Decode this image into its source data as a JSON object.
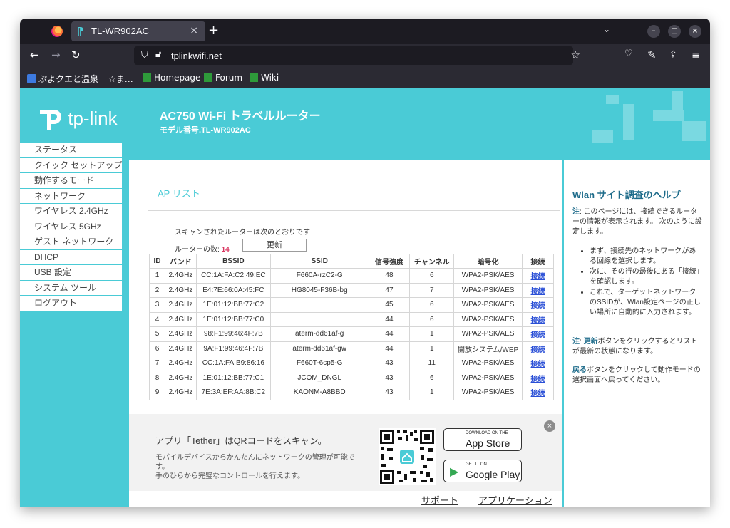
{
  "browser": {
    "tab_title": "TL-WR902AC",
    "tab_close": "×",
    "new_tab": "+",
    "url": "tplinkwifi.net",
    "bookmarks": [
      "ぷよクエと温泉",
      "☆ま…",
      "Homepage",
      "Forum",
      "Wiki"
    ]
  },
  "header": {
    "brand": "tp-link",
    "title": "AC750 Wi-Fi トラベルルーター",
    "model": "モデル番号.TL-WR902AC"
  },
  "sidebar": {
    "items": [
      "ステータス",
      "クイック セットアップ",
      "動作するモード",
      "ネットワーク",
      "ワイヤレス 2.4GHz",
      "ワイヤレス 5GHz",
      "ゲスト ネットワーク",
      "DHCP",
      "USB 設定",
      "システム ツール",
      "ログアウト"
    ]
  },
  "ap_list": {
    "title": "AP リスト",
    "scan_text": "スキャンされたルーターは次のとおりです",
    "count_label": "ルーターの数: ",
    "count": "14",
    "refresh_label": "更新",
    "columns": [
      "ID",
      "バンド",
      "BSSID",
      "SSID",
      "信号強度",
      "チャンネル",
      "暗号化",
      "接続"
    ],
    "rows": [
      [
        "1",
        "2.4GHz",
        "CC:1A:FA:C2:49:EC",
        "F660A-rzC2-G",
        "48",
        "6",
        "WPA2-PSK/AES",
        "接続"
      ],
      [
        "2",
        "2.4GHz",
        "E4:7E:66:0A:45:FC",
        "HG8045-F36B-bg",
        "47",
        "7",
        "WPA2-PSK/AES",
        "接続"
      ],
      [
        "3",
        "2.4GHz",
        "1E:01:12:BB:77:C2",
        "",
        "45",
        "6",
        "WPA2-PSK/AES",
        "接続"
      ],
      [
        "4",
        "2.4GHz",
        "1E:01:12:BB:77:C0",
        "",
        "44",
        "6",
        "WPA2-PSK/AES",
        "接続"
      ],
      [
        "5",
        "2.4GHz",
        "98:F1:99:46:4F:7B",
        "aterm-dd61af-g",
        "44",
        "1",
        "WPA2-PSK/AES",
        "接続"
      ],
      [
        "6",
        "2.4GHz",
        "9A:F1:99:46:4F:7B",
        "aterm-dd61af-gw",
        "44",
        "1",
        "開放システム/WEP",
        "接続"
      ],
      [
        "7",
        "2.4GHz",
        "CC:1A:FA:B9:86:16",
        "F660T-6cp5-G",
        "43",
        "11",
        "WPA2-PSK/AES",
        "接続"
      ],
      [
        "8",
        "2.4GHz",
        "1E:01:12:BB:77:C1",
        "JCOM_DNGL",
        "43",
        "6",
        "WPA2-PSK/AES",
        "接続"
      ],
      [
        "9",
        "2.4GHz",
        "7E:3A:EF:AA:8B:C2",
        "KAONM-A8BBD",
        "43",
        "1",
        "WPA2-PSK/AES",
        "接続"
      ]
    ]
  },
  "promo": {
    "heading": "アプリ「Tether」はQRコードをスキャン。",
    "body_1": "モバイルデバイスからかんたんにネットワークの管理が可能です。",
    "body_2": "手のひらから完璧なコントロールを行えます。",
    "appstore_small": "DOWNLOAD ON THE",
    "appstore_big": "App Store",
    "gplay_small": "GET IT ON",
    "gplay_big": "Google Play"
  },
  "footer": {
    "support": "サポート",
    "app": "アプリケーション"
  },
  "help": {
    "title": "Wlan サイト調査のヘルプ",
    "note_label": "注",
    "note1": ": このページには、接続できるルーターの情報が表示されます。 次のように設定します。",
    "steps": [
      "まず、接続先のネットワークがある回線を選択します。",
      "次に、その行の最後にある「接続」を確認します。",
      "これで、ターゲットネットワークのSSIDが、Wlan設定ページの正しい場所に自動的に入力されます。"
    ],
    "note2_label": "注",
    "note2_keyword": "更新",
    "note2": "ボタンをクリックするとリストが最新の状態になります。",
    "note3_keyword": "戻る",
    "note3": "ボタンをクリックして動作モードの選択画面へ戻ってください。"
  },
  "colors": {
    "accent": "#4acbd6",
    "browser_bg": "#2b2a33",
    "link": "#2a4fd6",
    "count": "#d9345f"
  }
}
